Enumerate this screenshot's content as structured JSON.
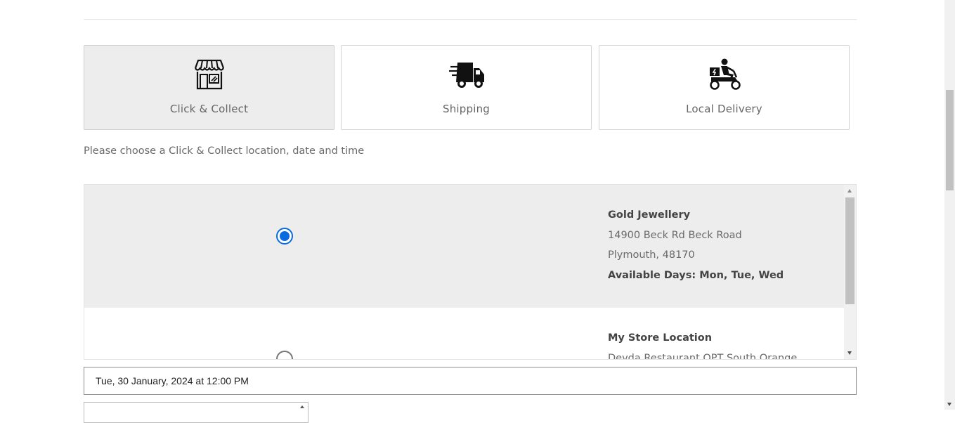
{
  "methods": [
    {
      "label": "Click & Collect",
      "icon": "store-icon",
      "active": true
    },
    {
      "label": "Shipping",
      "icon": "delivery-truck-icon",
      "active": false
    },
    {
      "label": "Local Delivery",
      "icon": "scooter-delivery-icon",
      "active": false
    }
  ],
  "instruction": "Please choose a Click & Collect location, date and time",
  "locations": [
    {
      "name": "Gold Jewellery",
      "address1": "14900 Beck Rd Beck Road",
      "address2": "Plymouth, 48170",
      "days": "Available Days: Mon, Tue, Wed",
      "selected": true
    },
    {
      "name": "My Store Location",
      "address1": "Devda Restaurant OPT South Orange",
      "selected": false
    }
  ],
  "date_field": {
    "value": "Tue, 30 January, 2024 at 12:00 PM"
  },
  "colors": {
    "accent": "#0a6be0",
    "selected_bg": "#ededed"
  }
}
